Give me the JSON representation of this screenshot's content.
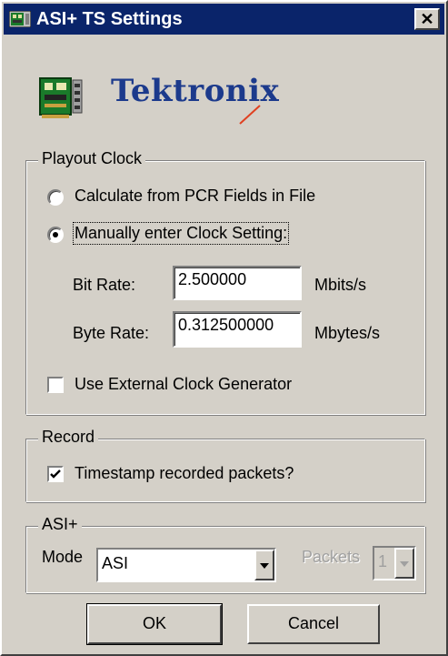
{
  "window": {
    "title": "ASI+ TS Settings",
    "close_glyph": "✕",
    "brand": "Tektronix",
    "app_icon": "network-card-icon"
  },
  "playout_clock": {
    "legend": "Playout Clock",
    "option_calculate": "Calculate from PCR Fields in File",
    "option_manual": "Manually enter Clock Setting:",
    "selected_option": "manual",
    "bit_rate_label": "Bit Rate:",
    "bit_rate_value": "2.500000",
    "bit_rate_unit": "Mbits/s",
    "byte_rate_label": "Byte Rate:",
    "byte_rate_value": "0.312500000",
    "byte_rate_unit": "Mbytes/s",
    "external_clock_label": "Use External Clock Generator",
    "external_clock_checked": false
  },
  "record": {
    "legend": "Record",
    "timestamp_label": "Timestamp recorded packets?",
    "timestamp_checked": true
  },
  "asi": {
    "legend": "ASI+",
    "mode_label": "Mode",
    "mode_value": "ASI",
    "packets_label": "Packets",
    "packets_value": "1"
  },
  "buttons": {
    "ok": "OK",
    "cancel": "Cancel"
  },
  "colors": {
    "titlebar": "#0a246a",
    "face": "#d4d0c8",
    "brand_blue": "#1c3a8c",
    "brand_accent": "#e04020"
  }
}
